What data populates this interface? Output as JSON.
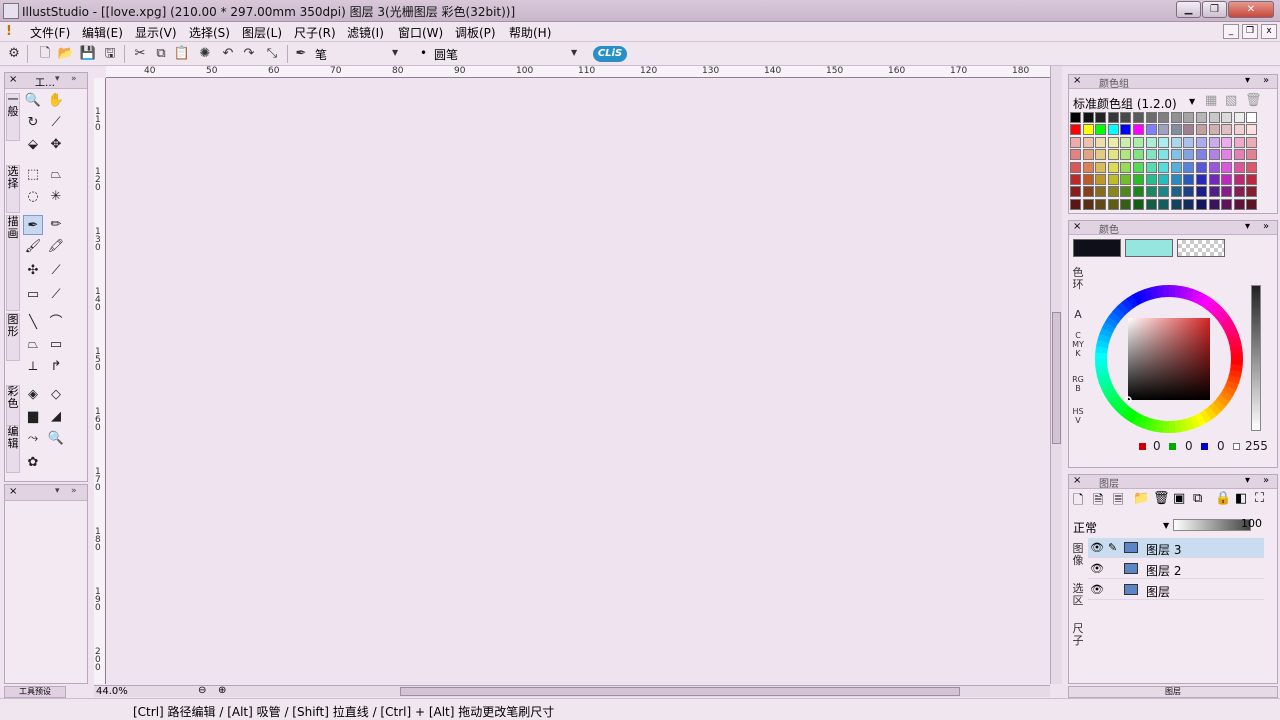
{
  "window": {
    "title": "IllustStudio - [[love.xpg] (210.00 * 297.00mm 350dpi)    图层 3(光栅图层 彩色(32bit))]",
    "minimize_icon": "minimize-icon",
    "restore_icon": "restore-icon",
    "close_icon": "close-icon"
  },
  "menu": {
    "items": [
      "文件(F)",
      "编辑(E)",
      "显示(V)",
      "选择(S)",
      "图层(L)",
      "尺子(R)",
      "滤镜(I)",
      "窗口(W)",
      "调板(P)",
      "帮助(H)"
    ]
  },
  "toolbar": {
    "tool_name": "笔",
    "brush_shape": "圆笔",
    "badge": "CLiS"
  },
  "tool_panel": {
    "header": "工…",
    "categories": [
      "一般",
      "选择",
      "描画",
      "图形",
      "彩色",
      "编辑"
    ],
    "footer_tab": "工具预设"
  },
  "ruler": {
    "top_ticks": [
      "40",
      "50",
      "60",
      "70",
      "80",
      "90",
      "100",
      "110",
      "120",
      "130",
      "140",
      "150",
      "160",
      "170",
      "180"
    ],
    "left_ticks": [
      "110",
      "120",
      "130",
      "140",
      "150",
      "160",
      "170",
      "180",
      "190",
      "200"
    ]
  },
  "zoom": {
    "value": "44.0%"
  },
  "color_set": {
    "panel_title": "颜色组",
    "set_name": "标准颜色组 (1.2.0)"
  },
  "color_panel": {
    "panel_title": "颜色",
    "side_tabs": [
      "色环",
      "A",
      "CMYK",
      "RGB",
      "HSV"
    ],
    "main_color": "#0f0f1a",
    "sub_color": "#96e6e0",
    "r": "0",
    "g": "0",
    "b": "0",
    "alpha": "255"
  },
  "layers": {
    "panel_title": "图层",
    "blend_mode": "正常",
    "opacity": "100",
    "side_tabs": [
      "图像",
      "选区",
      "尺子"
    ],
    "rows": [
      {
        "name": "图层 3",
        "selected": true
      },
      {
        "name": "图层 2",
        "selected": false
      },
      {
        "name": "图层",
        "selected": false
      }
    ],
    "footer": "图层"
  },
  "status": {
    "hint": "[Ctrl] 路径编辑 / [Alt] 吸管 / [Shift] 拉直线 / [Ctrl] + [Alt] 拖动更改笔刷尺寸"
  }
}
